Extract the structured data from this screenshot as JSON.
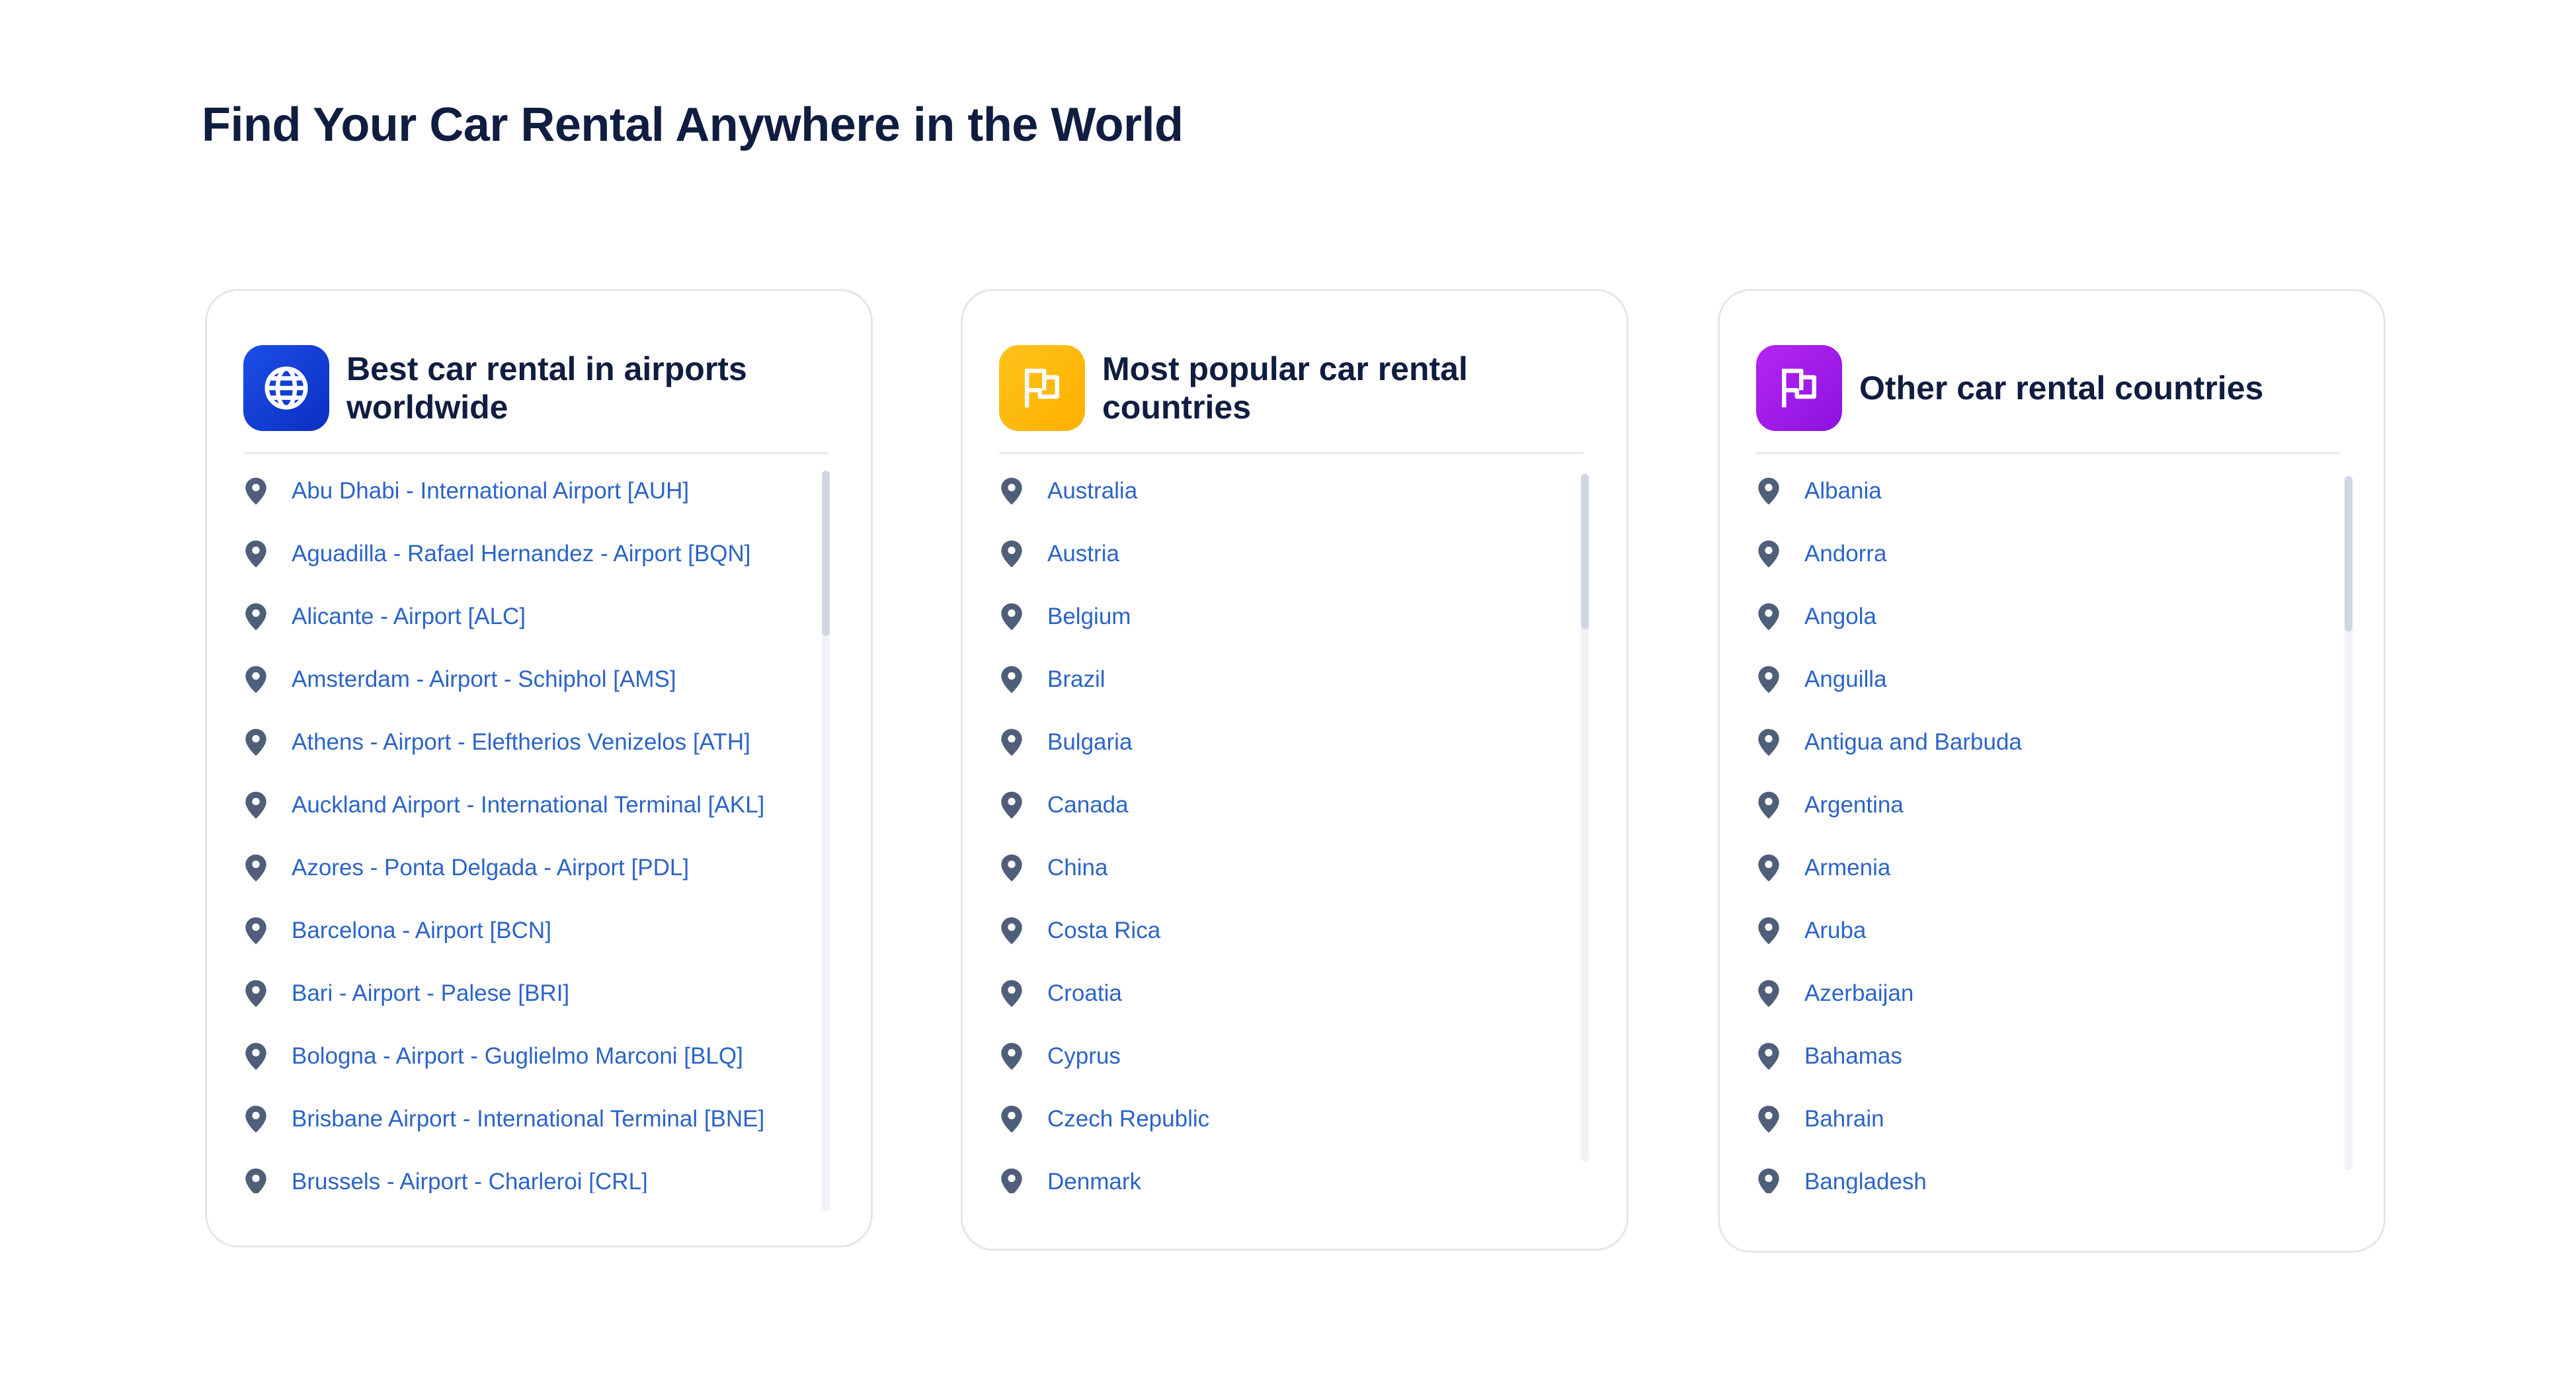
{
  "page": {
    "title": "Find Your Car Rental Anywhere in the World"
  },
  "colors": {
    "link": "#2c64c6",
    "title": "#0f1d40",
    "pin": "#4f5f7a"
  },
  "cards": [
    {
      "title": "Best car rental in airports worldwide",
      "icon": "globe-icon",
      "accent": "#1d4fe6",
      "items": [
        "Abu Dhabi - International Airport [AUH]",
        "Aguadilla - Rafael Hernandez - Airport [BQN]",
        "Alicante - Airport [ALC]",
        "Amsterdam - Airport - Schiphol [AMS]",
        "Athens - Airport - Eleftherios Venizelos [ATH]",
        "Auckland Airport - International Terminal [AKL]",
        "Azores - Ponta Delgada - Airport [PDL]",
        "Barcelona - Airport [BCN]",
        "Bari - Airport - Palese [BRI]",
        "Bologna - Airport - Guglielmo Marconi [BLQ]",
        "Brisbane Airport - International Terminal [BNE]",
        "Brussels - Airport - Charleroi [CRL]"
      ]
    },
    {
      "title": "Most popular car rental countries",
      "icon": "flag-icon",
      "accent": "#ffb800",
      "items": [
        "Australia",
        "Austria",
        "Belgium",
        "Brazil",
        "Bulgaria",
        "Canada",
        "China",
        "Costa Rica",
        "Croatia",
        "Cyprus",
        "Czech Republic",
        "Denmark"
      ]
    },
    {
      "title": "Other car rental countries",
      "icon": "flag-icon",
      "accent": "#a11ee8",
      "items": [
        "Albania",
        "Andorra",
        "Angola",
        "Anguilla",
        "Antigua and Barbuda",
        "Argentina",
        "Armenia",
        "Aruba",
        "Azerbaijan",
        "Bahamas",
        "Bahrain",
        "Bangladesh"
      ]
    }
  ]
}
